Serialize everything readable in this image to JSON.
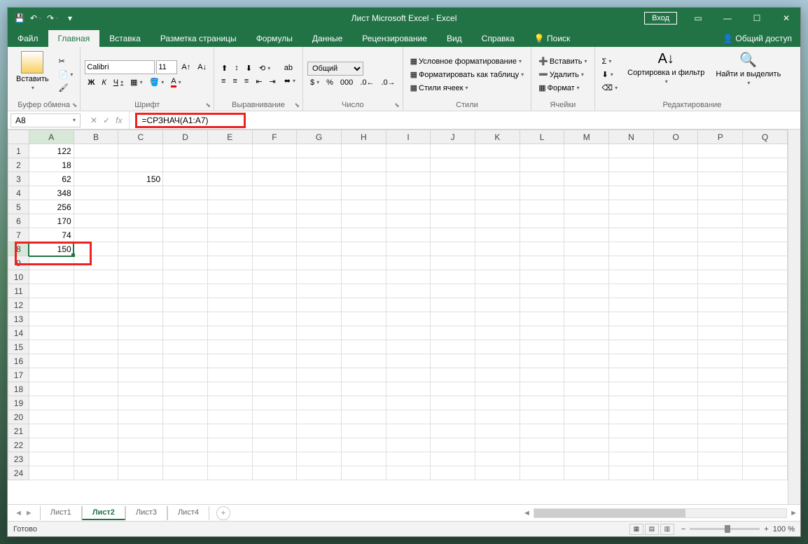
{
  "titlebar": {
    "title": "Лист Microsoft Excel  -  Excel",
    "login": "Вход"
  },
  "menu": {
    "file": "Файл",
    "tabs": [
      "Главная",
      "Вставка",
      "Разметка страницы",
      "Формулы",
      "Данные",
      "Рецензирование",
      "Вид",
      "Справка"
    ],
    "active": 0,
    "search": "Поиск",
    "share": "Общий доступ"
  },
  "ribbon": {
    "clipboard": {
      "label": "Буфер обмена",
      "paste": "Вставить"
    },
    "font": {
      "label": "Шрифт",
      "name": "Calibri",
      "size": "11",
      "bold": "Ж",
      "italic": "К",
      "underline": "Ч"
    },
    "alignment": {
      "label": "Выравнивание"
    },
    "number": {
      "label": "Число",
      "format": "Общий"
    },
    "styles": {
      "label": "Стили",
      "cond": "Условное форматирование",
      "table": "Форматировать как таблицу",
      "cell": "Стили ячеек"
    },
    "cells": {
      "label": "Ячейки",
      "insert": "Вставить",
      "delete": "Удалить",
      "format": "Формат"
    },
    "editing": {
      "label": "Редактирование",
      "sort": "Сортировка и фильтр",
      "find": "Найти и выделить"
    }
  },
  "formula": {
    "cellref": "A8",
    "formula": "=СРЗНАЧ(A1:A7)"
  },
  "columns": [
    "A",
    "B",
    "C",
    "D",
    "E",
    "F",
    "G",
    "H",
    "I",
    "J",
    "K",
    "L",
    "M",
    "N",
    "O",
    "P",
    "Q"
  ],
  "rows": [
    1,
    2,
    3,
    4,
    5,
    6,
    7,
    8,
    9,
    10,
    11,
    12,
    13,
    14,
    15,
    16,
    17,
    18,
    19,
    20,
    21,
    22,
    23,
    24
  ],
  "cells": {
    "A1": "122",
    "A2": "18",
    "A3": "62",
    "C3": "150",
    "A4": "348",
    "A5": "256",
    "A6": "170",
    "A7": "74",
    "A8": "150"
  },
  "active_cell": "A8",
  "sheets": [
    "Лист1",
    "Лист2",
    "Лист3",
    "Лист4"
  ],
  "active_sheet": 1,
  "status": {
    "ready": "Готово",
    "zoom": "100 %"
  }
}
